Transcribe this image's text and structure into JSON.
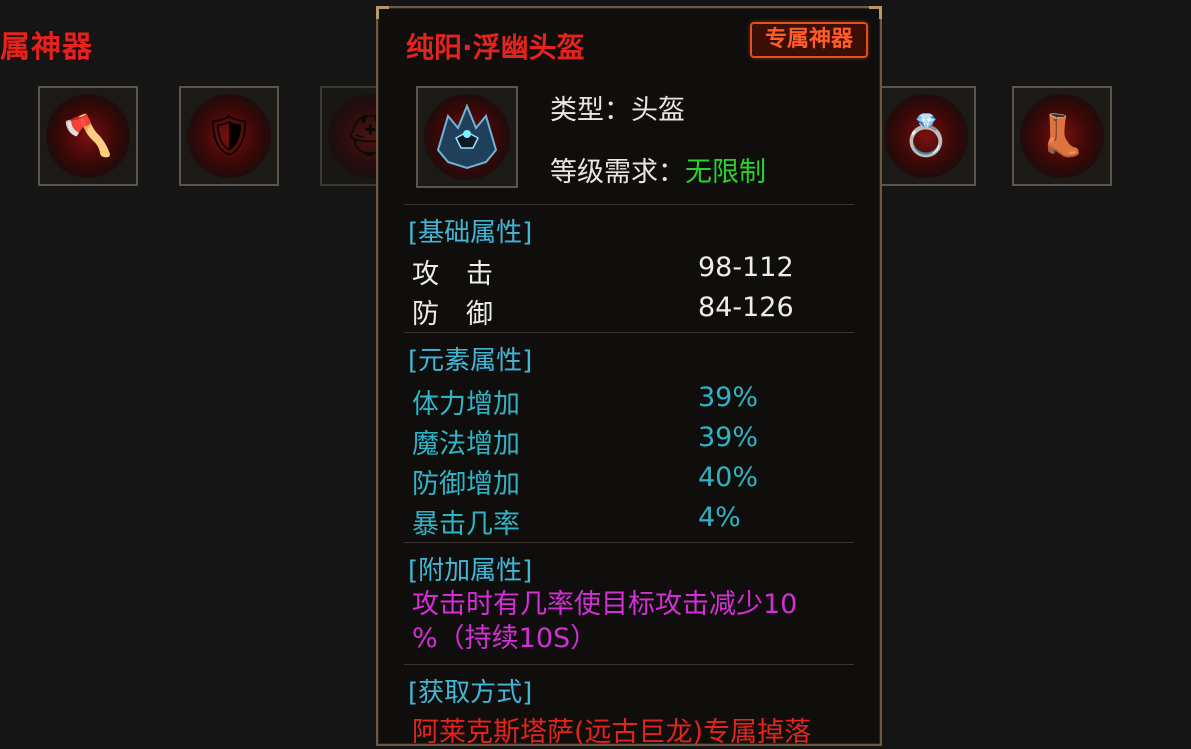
{
  "page": {
    "section_title": "属神器"
  },
  "slots": [
    {
      "icon": "weapon-icon",
      "glyph": "🪓"
    },
    {
      "icon": "armor-icon",
      "glyph": "🛡"
    },
    {
      "icon": "helmet-icon",
      "glyph": "⛑"
    },
    {
      "icon": "necklace-icon",
      "glyph": ""
    },
    {
      "icon": "bracer-icon",
      "glyph": ""
    },
    {
      "icon": "glove-icon",
      "glyph": ""
    },
    {
      "icon": "belt-icon",
      "glyph": "💍"
    },
    {
      "icon": "boots-icon",
      "glyph": "👢"
    }
  ],
  "tooltip": {
    "name": "纯阳·浮幽头盔",
    "badge": "专属神器",
    "type_label": "类型：",
    "type_value": "头盔",
    "level_label": "等级需求：",
    "level_value": "无限制",
    "basic": {
      "header": "[基础属性]",
      "rows": [
        {
          "name": "攻　击",
          "value": "98-112"
        },
        {
          "name": "防　御",
          "value": "84-126"
        }
      ]
    },
    "element": {
      "header": "[元素属性]",
      "rows": [
        {
          "name": "体力增加",
          "value": "39%"
        },
        {
          "name": "魔法增加",
          "value": "39%"
        },
        {
          "name": "防御增加",
          "value": "40%"
        },
        {
          "name": "暴击几率",
          "value": "4%"
        }
      ]
    },
    "extra": {
      "header": "[附加属性]",
      "text_line1": "攻击时有几率使目标攻击减少10",
      "text_line2": "%（持续10S）"
    },
    "source": {
      "header": "[获取方式]",
      "text": "阿莱克斯塔萨(远古巨龙)专属掉落"
    }
  }
}
